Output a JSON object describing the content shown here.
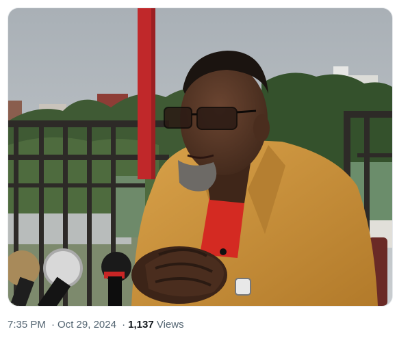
{
  "media": {
    "description_icon": "photo"
  },
  "meta": {
    "time": "7:35 PM",
    "separator": "·",
    "date": "Oct 29, 2024",
    "views_count": "1,137",
    "views_label": "Views"
  },
  "colors": {
    "text_secondary": "#536471",
    "text_primary": "#0f1419",
    "jacket": "#c8913a",
    "shirt": "#d42a22",
    "pole": "#c0282a"
  }
}
